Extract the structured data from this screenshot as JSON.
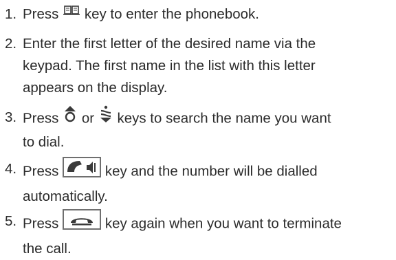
{
  "steps": [
    {
      "number": "1.",
      "before": "Press",
      "icon": "phonebook-icon",
      "after": "key to enter the phonebook."
    },
    {
      "number": "2.",
      "lines": [
        "Enter the first letter of the desired name via the",
        "keypad. The first name in the list with this letter",
        "appears on the display."
      ]
    },
    {
      "number": "3.",
      "before": "Press",
      "icon": "scroll-up-icon",
      "middle": "or",
      "icon2": "scroll-down-icon",
      "after": "keys to search the name you want",
      "line2": "to dial."
    },
    {
      "number": "4.",
      "before": "Press",
      "icon": "call-key-icon",
      "after": "key and the number will be dialled",
      "line2": "automatically."
    },
    {
      "number": "5.",
      "before": "Press",
      "icon": "end-call-key-icon",
      "after": "key again when you want to terminate",
      "line2": "the call."
    }
  ],
  "colors": {
    "text": "#2b2b2b",
    "icon": "#3a3a3a",
    "key_border": "#6f6f6f"
  }
}
